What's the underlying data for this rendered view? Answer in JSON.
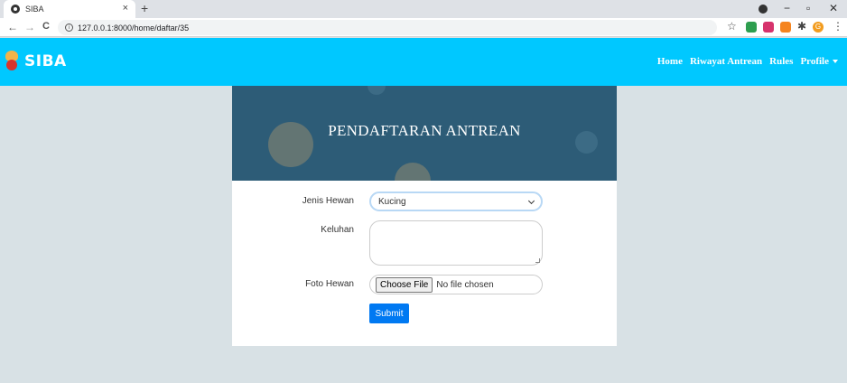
{
  "browser": {
    "tab_title": "SIBA",
    "tab_close": "×",
    "new_tab": "+",
    "url": "127.0.0.1:8000/home/daftar/35",
    "url_info": "i",
    "back": "←",
    "forward": "→",
    "reload": "C",
    "minimize": "−",
    "maximize": "▫",
    "close": "✕",
    "bookmark_star": "☆",
    "extensions_icon": "✱",
    "menu": "⋮",
    "profile_initial": "G"
  },
  "app": {
    "brand": "SIBA",
    "nav": {
      "home": "Home",
      "riwayat": "Riwayat Antrean",
      "rules": "Rules",
      "profile": "Profile"
    }
  },
  "card": {
    "title": "PENDAFTARAN ANTREAN"
  },
  "form": {
    "jenis_hewan": {
      "label": "Jenis Hewan",
      "value": "Kucing"
    },
    "keluhan": {
      "label": "Keluhan",
      "value": ""
    },
    "foto_hewan": {
      "label": "Foto Hewan",
      "button": "Choose File",
      "status": "No file chosen"
    },
    "submit": "Submit"
  },
  "colors": {
    "nav_bg": "#00c8ff",
    "banner_bg": "#2d5c77",
    "submit_bg": "#0079f2",
    "page_bg": "#d8e1e5"
  }
}
